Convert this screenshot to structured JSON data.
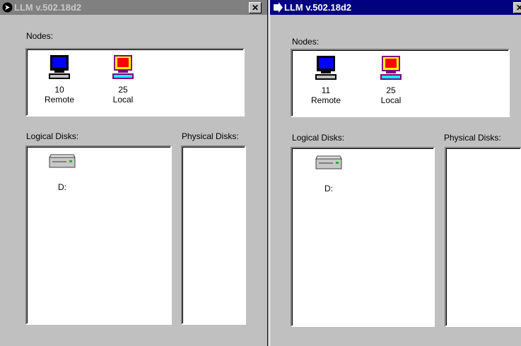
{
  "windows": [
    {
      "title": "LLM v.502.18d2",
      "active": false,
      "nodes_label": "Nodes:",
      "nodes": [
        {
          "count": "10",
          "name": "Remote",
          "icon": "remote-computer-icon"
        },
        {
          "count": "25",
          "name": "Local",
          "icon": "local-computer-icon"
        }
      ],
      "logical_label": "Logical Disks:",
      "physical_label": "Physical Disks:",
      "disks": [
        {
          "name": "D:",
          "icon": "disk-drive-icon"
        }
      ]
    },
    {
      "title": "LLM v.502.18d2",
      "active": true,
      "nodes_label": "Nodes:",
      "nodes": [
        {
          "count": "11",
          "name": "Remote",
          "icon": "remote-computer-icon"
        },
        {
          "count": "25",
          "name": "Local",
          "icon": "local-computer-icon"
        }
      ],
      "logical_label": "Logical Disks:",
      "physical_label": "Physical Disks:",
      "disks": [
        {
          "name": "D:",
          "icon": "disk-drive-icon"
        }
      ]
    }
  ],
  "colors": {
    "active_title": "#000080",
    "inactive_title": "#808080",
    "face": "#c0c0c0"
  }
}
